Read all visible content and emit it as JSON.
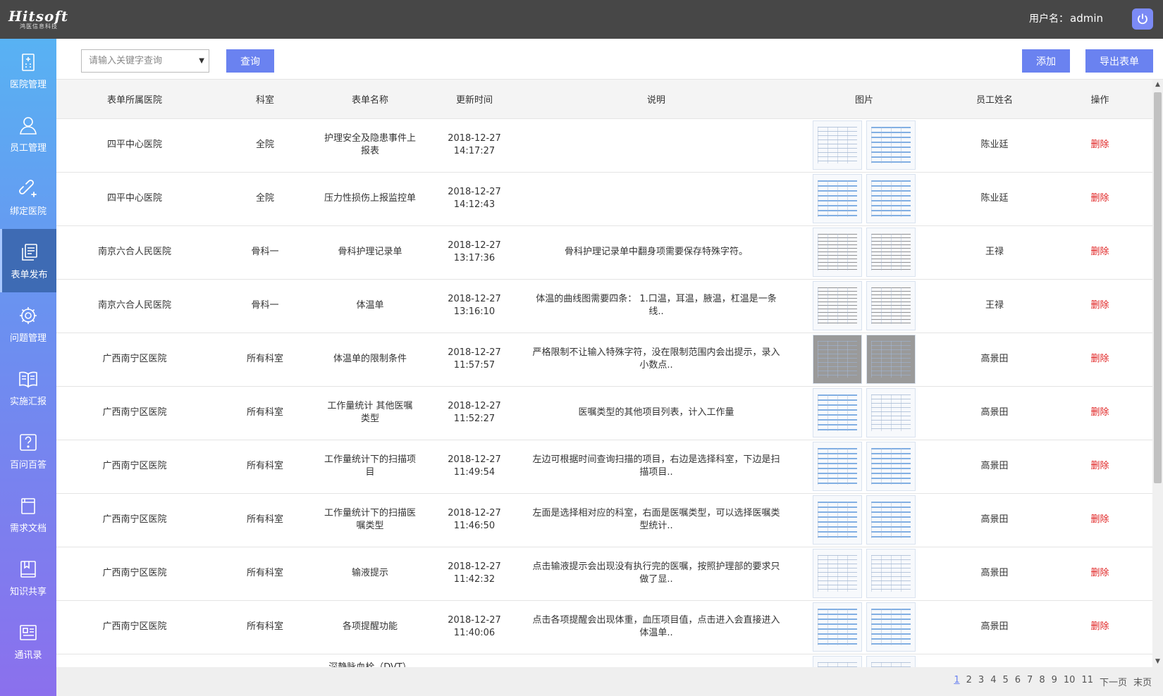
{
  "header": {
    "logo_main": "Hitsoft",
    "logo_sub": "鸿医信息科技",
    "user_label": "用户名：",
    "user_name": "admin"
  },
  "sidebar": {
    "items": [
      {
        "label": "医院管理",
        "icon": "hospital-icon"
      },
      {
        "label": "员工管理",
        "icon": "user-icon"
      },
      {
        "label": "绑定医院",
        "icon": "link-icon"
      },
      {
        "label": "表单发布",
        "icon": "form-icon",
        "active": true
      },
      {
        "label": "问题管理",
        "icon": "gear-icon"
      },
      {
        "label": "实施汇报",
        "icon": "book-icon"
      },
      {
        "label": "百问百答",
        "icon": "question-icon"
      },
      {
        "label": "需求文档",
        "icon": "document-icon"
      },
      {
        "label": "知识共享",
        "icon": "knowledge-icon"
      },
      {
        "label": "通讯录",
        "icon": "contacts-icon"
      }
    ]
  },
  "toolbar": {
    "search_placeholder": "请输入关键字查询",
    "query_label": "查询",
    "add_label": "添加",
    "export_label": "导出表单"
  },
  "table": {
    "columns": [
      "表单所属医院",
      "科室",
      "表单名称",
      "更新时间",
      "说明",
      "图片",
      "员工姓名",
      "操作"
    ],
    "rows": [
      {
        "hospital": "四平中心医院",
        "dept": "全院",
        "name": "护理安全及隐患事件上报表",
        "time": "2018-12-27 14:17:27",
        "desc": "",
        "staff": "陈业廷",
        "action": "删除"
      },
      {
        "hospital": "四平中心医院",
        "dept": "全院",
        "name": "压力性损伤上报监控单",
        "time": "2018-12-27 14:12:43",
        "desc": "",
        "staff": "陈业廷",
        "action": "删除"
      },
      {
        "hospital": "南京六合人民医院",
        "dept": "骨科一",
        "name": "骨科护理记录单",
        "time": "2018-12-27 13:17:36",
        "desc": "骨科护理记录单中翻身项需要保存特殊字符。",
        "staff": "王禄",
        "action": "删除"
      },
      {
        "hospital": "南京六合人民医院",
        "dept": "骨科一",
        "name": "体温单",
        "time": "2018-12-27 13:16:10",
        "desc": "体温的曲线图需要四条： 1.口温，耳温，腋温，杠温是一条线..",
        "staff": "王禄",
        "action": "删除"
      },
      {
        "hospital": "广西南宁区医院",
        "dept": "所有科室",
        "name": "体温单的限制条件",
        "time": "2018-12-27 11:57:57",
        "desc": "严格限制不让输入特殊字符，没在限制范围内会出提示，录入小数点..",
        "staff": "高景田",
        "action": "删除"
      },
      {
        "hospital": "广西南宁区医院",
        "dept": "所有科室",
        "name": "工作量统计 其他医嘱类型",
        "time": "2018-12-27 11:52:27",
        "desc": "医嘱类型的其他项目列表，计入工作量",
        "staff": "高景田",
        "action": "删除"
      },
      {
        "hospital": "广西南宁区医院",
        "dept": "所有科室",
        "name": "工作量统计下的扫描项目",
        "time": "2018-12-27 11:49:54",
        "desc": "左边可根据时间查询扫描的项目，右边是选择科室，下边是扫描项目..",
        "staff": "高景田",
        "action": "删除"
      },
      {
        "hospital": "广西南宁区医院",
        "dept": "所有科室",
        "name": "工作量统计下的扫描医嘱类型",
        "time": "2018-12-27 11:46:50",
        "desc": "左面是选择相对应的科室，右面是医嘱类型，可以选择医嘱类型统计..",
        "staff": "高景田",
        "action": "删除"
      },
      {
        "hospital": "广西南宁区医院",
        "dept": "所有科室",
        "name": "输液提示",
        "time": "2018-12-27 11:42:32",
        "desc": "点击输液提示会出现没有执行完的医嘱，按照护理部的要求只做了显..",
        "staff": "高景田",
        "action": "删除"
      },
      {
        "hospital": "广西南宁区医院",
        "dept": "所有科室",
        "name": "各项提醒功能",
        "time": "2018-12-27 11:40:06",
        "desc": "点击各项提醒会出现体重，血压项目值，点击进入会直接进入体温单..",
        "staff": "高景田",
        "action": "删除"
      },
      {
        "hospital": "",
        "dept": "",
        "name": "深静脉血栓（DVT）",
        "time": "",
        "desc": "",
        "staff": "",
        "action": ""
      }
    ]
  },
  "pagination": {
    "pages": [
      "1",
      "2",
      "3",
      "4",
      "5",
      "6",
      "7",
      "8",
      "9",
      "10",
      "11"
    ],
    "current": "1",
    "next_label": "下一页",
    "last_label": "末页"
  }
}
